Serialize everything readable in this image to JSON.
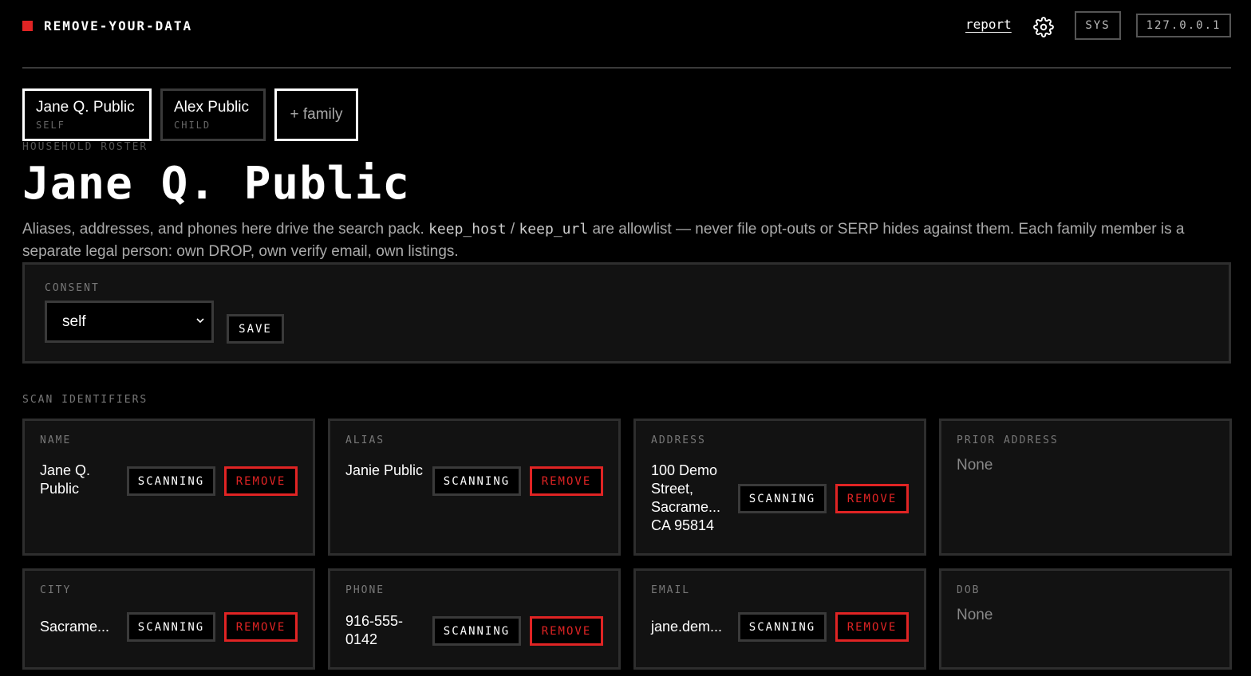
{
  "header": {
    "brand": "REMOVE-YOUR-DATA",
    "report_link": "report",
    "sys_button": "SYS",
    "host": "127.0.0.1",
    "accent_color": "#e02424"
  },
  "roster": {
    "tabs": [
      {
        "name": "Jane Q. Public",
        "role": "SELF",
        "active": true
      },
      {
        "name": "Alex Public",
        "role": "CHILD",
        "active": false
      }
    ],
    "add_label": "+ family",
    "section_label": "HOUSEHOLD ROSTER"
  },
  "profile": {
    "title": "Jane Q. Public",
    "desc_part1": "Aliases, addresses, and phones here drive the search pack. ",
    "desc_code1": "keep_host",
    "desc_sep": " / ",
    "desc_code2": "keep_url",
    "desc_part2": " are allowlist — never file opt-outs or SERP hides against them. Each family member is a separate legal person: own DROP, own verify email, own listings."
  },
  "consent": {
    "label": "CONSENT",
    "selected": "self",
    "save_label": "SAVE"
  },
  "identifiers": {
    "section_label": "SCAN IDENTIFIERS",
    "scan_label": "SCANNING",
    "remove_label": "REMOVE",
    "cards": [
      {
        "label": "NAME",
        "value": "Jane Q. Public"
      },
      {
        "label": "ALIAS",
        "value": "Janie Public"
      },
      {
        "label": "ADDRESS",
        "value": "100 Demo Street, Sacrame... CA 95814"
      },
      {
        "label": "PRIOR ADDRESS",
        "value": "None"
      },
      {
        "label": "CITY",
        "value": "Sacrame..."
      },
      {
        "label": "PHONE",
        "value": "916-555-0142"
      },
      {
        "label": "EMAIL",
        "value": "jane.dem..."
      },
      {
        "label": "DOB",
        "value": "None"
      }
    ]
  }
}
